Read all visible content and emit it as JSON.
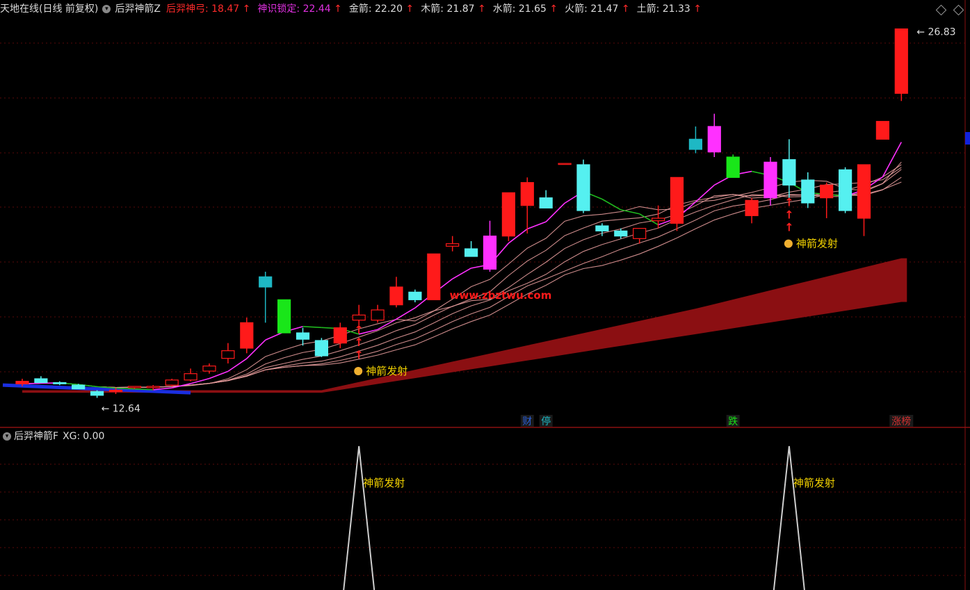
{
  "header": {
    "title": "天地在线(日线 前复权)",
    "indicator_name": "后羿神箭Z",
    "items": [
      {
        "label": "后羿神弓:",
        "value": "18.47",
        "arrow": "↑",
        "color": "#ff2a2a"
      },
      {
        "label": "神识锁定:",
        "value": "22.44",
        "arrow": "↑",
        "color": "#e030e0"
      },
      {
        "label": "金箭:",
        "value": "22.20",
        "arrow": "↑",
        "color": "#dddddd"
      },
      {
        "label": "木箭:",
        "value": "21.87",
        "arrow": "↑",
        "color": "#dddddd"
      },
      {
        "label": "水箭:",
        "value": "21.65",
        "arrow": "↑",
        "color": "#dddddd"
      },
      {
        "label": "火箭:",
        "value": "21.47",
        "arrow": "↑",
        "color": "#dddddd"
      },
      {
        "label": "土箭:",
        "value": "21.33",
        "arrow": "↑",
        "color": "#dddddd"
      }
    ]
  },
  "sub_header": {
    "indicator_name": "后羿神箭F",
    "xg_label": "XG:",
    "xg_value": "0.00"
  },
  "watermark": "www.zbztwu.com",
  "colors": {
    "up": "#ff1a1a",
    "down": "#55f0f0",
    "cyan_dark": "#1eb8c4",
    "magenta": "#ff30ff",
    "green": "#19e619",
    "ribbon": "#8b0f12",
    "yellow": "#f0d000",
    "grid": "#5a0a0a"
  },
  "chart_data": {
    "type": "candlestick",
    "ylim": [
      11.6,
      27.2
    ],
    "high_label": "26.83",
    "low_label": "12.64",
    "candles": [
      {
        "o": 13.0,
        "h": 13.1,
        "l": 12.8,
        "c": 12.9,
        "color": "#ff1a1a"
      },
      {
        "o": 13.1,
        "h": 13.2,
        "l": 12.95,
        "c": 12.95,
        "color": "#55f0f0"
      },
      {
        "o": 12.9,
        "h": 13.0,
        "l": 12.85,
        "c": 12.95,
        "color": "#55f0f0"
      },
      {
        "o": 12.85,
        "h": 12.9,
        "l": 12.7,
        "c": 12.7,
        "color": "#55f0f0"
      },
      {
        "o": 12.6,
        "h": 12.65,
        "l": 12.35,
        "c": 12.45,
        "color": "#55f0f0"
      },
      {
        "o": 12.65,
        "h": 12.75,
        "l": 12.5,
        "c": 12.6,
        "color": "#ff1a1a"
      },
      {
        "o": 12.75,
        "h": 12.8,
        "l": 12.7,
        "c": 12.8,
        "color": "#ff1a1a"
      },
      {
        "o": 12.75,
        "h": 12.85,
        "l": 12.65,
        "c": 12.8,
        "color": "#ff1a1a"
      },
      {
        "o": 12.85,
        "h": 13.1,
        "l": 12.8,
        "c": 13.05,
        "color": "#ff1a1a"
      },
      {
        "o": 13.05,
        "h": 13.5,
        "l": 13.0,
        "c": 13.3,
        "color": "#ff1a1a"
      },
      {
        "o": 13.4,
        "h": 13.7,
        "l": 13.3,
        "c": 13.6,
        "color": "#ff1a1a"
      },
      {
        "o": 13.9,
        "h": 14.5,
        "l": 13.7,
        "c": 14.2,
        "color": "#ff1a1a"
      },
      {
        "o": 14.3,
        "h": 15.5,
        "l": 14.1,
        "c": 15.3,
        "color": "#ff1a1a"
      },
      {
        "o": 17.1,
        "h": 17.3,
        "l": 15.3,
        "c": 16.7,
        "color": "#1eb8c4"
      },
      {
        "o": 16.2,
        "h": 16.2,
        "l": 14.9,
        "c": 14.9,
        "color": "#19e619"
      },
      {
        "o": 14.9,
        "h": 15.1,
        "l": 14.4,
        "c": 14.65,
        "color": "#55f0f0"
      },
      {
        "o": 14.6,
        "h": 14.7,
        "l": 13.95,
        "c": 14.0,
        "color": "#55f0f0"
      },
      {
        "o": 14.5,
        "h": 15.3,
        "l": 14.3,
        "c": 15.1,
        "color": "#ff1a1a"
      },
      {
        "o": 15.4,
        "h": 16.0,
        "l": 15.2,
        "c": 15.6,
        "color": "#ff1a1a"
      },
      {
        "o": 15.4,
        "h": 16.0,
        "l": 15.3,
        "c": 15.8,
        "color": "#ff1a1a"
      },
      {
        "o": 16.0,
        "h": 17.1,
        "l": 15.9,
        "c": 16.7,
        "color": "#ff1a1a"
      },
      {
        "o": 16.5,
        "h": 16.6,
        "l": 16.1,
        "c": 16.2,
        "color": "#55f0f0"
      },
      {
        "o": 16.2,
        "h": 18.0,
        "l": 16.2,
        "c": 18.0,
        "color": "#ff1a1a"
      },
      {
        "o": 18.3,
        "h": 18.7,
        "l": 18.1,
        "c": 18.4,
        "color": "#ff1a1a"
      },
      {
        "o": 18.2,
        "h": 18.5,
        "l": 17.9,
        "c": 17.9,
        "color": "#55f0f0"
      },
      {
        "o": 18.7,
        "h": 19.3,
        "l": 17.3,
        "c": 17.4,
        "color": "#ff30ff"
      },
      {
        "o": 18.7,
        "h": 20.4,
        "l": 18.5,
        "c": 20.4,
        "color": "#ff1a1a"
      },
      {
        "o": 19.9,
        "h": 21.0,
        "l": 18.8,
        "c": 20.8,
        "color": "#ff1a1a"
      },
      {
        "o": 20.2,
        "h": 20.5,
        "l": 19.8,
        "c": 19.8,
        "color": "#55f0f0"
      },
      {
        "o": 21.55,
        "h": 21.55,
        "l": 21.55,
        "c": 21.55,
        "color": "#ff1a1a"
      },
      {
        "o": 21.5,
        "h": 21.7,
        "l": 19.6,
        "c": 19.7,
        "color": "#55f0f0"
      },
      {
        "o": 19.1,
        "h": 19.2,
        "l": 18.7,
        "c": 18.9,
        "color": "#55f0f0"
      },
      {
        "o": 18.9,
        "h": 19.0,
        "l": 18.6,
        "c": 18.7,
        "color": "#55f0f0"
      },
      {
        "o": 18.6,
        "h": 19.0,
        "l": 18.4,
        "c": 19.0,
        "color": "#ff1a1a"
      },
      {
        "o": 19.3,
        "h": 19.9,
        "l": 19.0,
        "c": 19.4,
        "color": "#ff1a1a"
      },
      {
        "o": 19.2,
        "h": 21.0,
        "l": 18.9,
        "c": 21.0,
        "color": "#ff1a1a"
      },
      {
        "o": 22.5,
        "h": 23.0,
        "l": 21.95,
        "c": 22.1,
        "color": "#1eb8c4"
      },
      {
        "o": 23.0,
        "h": 23.5,
        "l": 21.8,
        "c": 22.0,
        "color": "#ff30ff"
      },
      {
        "o": 21.8,
        "h": 21.9,
        "l": 21.0,
        "c": 21.0,
        "color": "#19e619"
      },
      {
        "o": 19.5,
        "h": 20.2,
        "l": 19.2,
        "c": 20.1,
        "color": "#ff1a1a"
      },
      {
        "o": 21.6,
        "h": 21.8,
        "l": 19.9,
        "c": 20.2,
        "color": "#ff30ff"
      },
      {
        "o": 21.7,
        "h": 22.5,
        "l": 20.2,
        "c": 20.7,
        "color": "#55f0f0"
      },
      {
        "o": 20.9,
        "h": 21.2,
        "l": 19.8,
        "c": 20.0,
        "color": "#55f0f0"
      },
      {
        "o": 20.2,
        "h": 20.8,
        "l": 19.4,
        "c": 20.7,
        "color": "#ff1a1a"
      },
      {
        "o": 21.3,
        "h": 21.4,
        "l": 19.6,
        "c": 19.7,
        "color": "#55f0f0"
      },
      {
        "o": 19.4,
        "h": 21.5,
        "l": 18.7,
        "c": 21.5,
        "color": "#ff1a1a"
      },
      {
        "o": 22.5,
        "h": 23.2,
        "l": 22.5,
        "c": 23.2,
        "color": "#ff1a1a"
      },
      {
        "o": 24.3,
        "h": 26.83,
        "l": 24.0,
        "c": 26.83,
        "color": "#ff1a1a"
      }
    ],
    "signals": [
      {
        "index": 18,
        "label": "神箭发射"
      },
      {
        "index": 41,
        "label": "神箭发射"
      }
    ],
    "bottom_badges": [
      {
        "index": 27,
        "text": "财",
        "color": "#2a5fd8"
      },
      {
        "index": 28,
        "text": "停",
        "color": "#1eb8c4"
      },
      {
        "index": 38,
        "text": "跌",
        "color": "#19e619"
      },
      {
        "index": 47,
        "text": "涨榜",
        "color": "#d23030"
      }
    ]
  }
}
